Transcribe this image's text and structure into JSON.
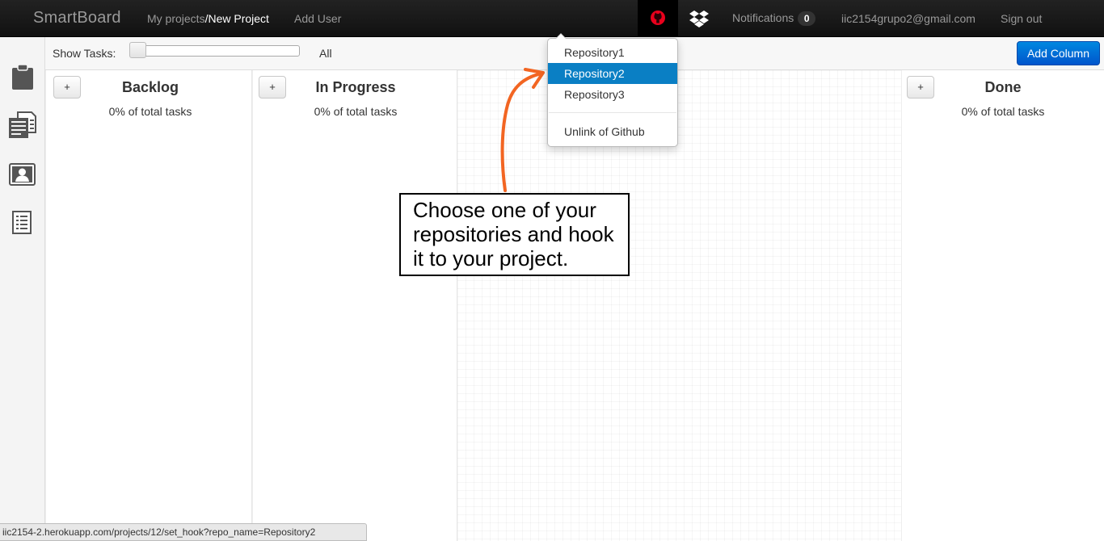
{
  "navbar": {
    "brand": "SmartBoard",
    "breadcrumb_root": "My projects",
    "breadcrumb_current": "/New Project",
    "add_user": "Add User",
    "github_icon": "github-octocat-icon",
    "dropbox_icon": "dropbox-icon",
    "notifications_label": "Notifications",
    "notifications_count": "0",
    "user_email": "iic2154grupo2@gmail.com",
    "sign_out": "Sign out"
  },
  "sidebar": {
    "items": [
      {
        "icon": "clipboard-icon"
      },
      {
        "icon": "documents-icon"
      },
      {
        "icon": "user-profile-icon"
      },
      {
        "icon": "report-icon"
      }
    ]
  },
  "toolbar": {
    "show_tasks_label": "Show Tasks:",
    "slider_value_label": "All",
    "slider_level": 0,
    "add_column": "Add Column"
  },
  "board": {
    "columns": [
      {
        "title": "Backlog",
        "stat": "0% of total tasks",
        "add": "+"
      },
      {
        "title": "In Progress",
        "stat": "0% of total tasks",
        "add": "+"
      },
      {
        "title": "Done",
        "stat": "0% of total tasks",
        "add": "+"
      }
    ]
  },
  "github_dropdown": {
    "items": [
      "Repository1",
      "Repository2",
      "Repository3"
    ],
    "active_item": "Repository2",
    "unlink": "Unlink of Github"
  },
  "annotation": {
    "text": "Choose one of your repositories and hook it to your project.",
    "arrow_color": "#f26522"
  },
  "status_bar": {
    "url": "iic2154-2.herokuapp.com/projects/12/set_hook?repo_name=Repository2"
  },
  "colors": {
    "navbar_bg": "#111111",
    "accent_blue": "#0066dd",
    "dropdown_active": "#0a7fc4",
    "github_icon": "#e8001c"
  }
}
